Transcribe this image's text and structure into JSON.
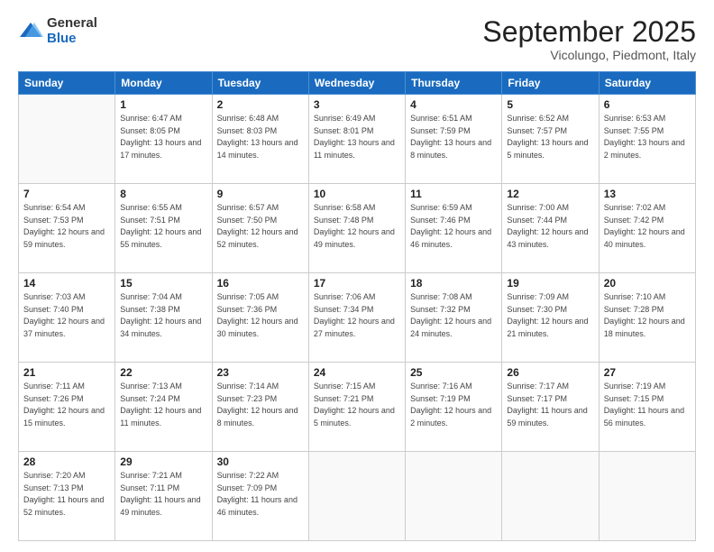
{
  "logo": {
    "general": "General",
    "blue": "Blue"
  },
  "header": {
    "title": "September 2025",
    "location": "Vicolungo, Piedmont, Italy"
  },
  "weekdays": [
    "Sunday",
    "Monday",
    "Tuesday",
    "Wednesday",
    "Thursday",
    "Friday",
    "Saturday"
  ],
  "weeks": [
    [
      {
        "day": "",
        "sunrise": "",
        "sunset": "",
        "daylight": ""
      },
      {
        "day": "1",
        "sunrise": "Sunrise: 6:47 AM",
        "sunset": "Sunset: 8:05 PM",
        "daylight": "Daylight: 13 hours and 17 minutes."
      },
      {
        "day": "2",
        "sunrise": "Sunrise: 6:48 AM",
        "sunset": "Sunset: 8:03 PM",
        "daylight": "Daylight: 13 hours and 14 minutes."
      },
      {
        "day": "3",
        "sunrise": "Sunrise: 6:49 AM",
        "sunset": "Sunset: 8:01 PM",
        "daylight": "Daylight: 13 hours and 11 minutes."
      },
      {
        "day": "4",
        "sunrise": "Sunrise: 6:51 AM",
        "sunset": "Sunset: 7:59 PM",
        "daylight": "Daylight: 13 hours and 8 minutes."
      },
      {
        "day": "5",
        "sunrise": "Sunrise: 6:52 AM",
        "sunset": "Sunset: 7:57 PM",
        "daylight": "Daylight: 13 hours and 5 minutes."
      },
      {
        "day": "6",
        "sunrise": "Sunrise: 6:53 AM",
        "sunset": "Sunset: 7:55 PM",
        "daylight": "Daylight: 13 hours and 2 minutes."
      }
    ],
    [
      {
        "day": "7",
        "sunrise": "Sunrise: 6:54 AM",
        "sunset": "Sunset: 7:53 PM",
        "daylight": "Daylight: 12 hours and 59 minutes."
      },
      {
        "day": "8",
        "sunrise": "Sunrise: 6:55 AM",
        "sunset": "Sunset: 7:51 PM",
        "daylight": "Daylight: 12 hours and 55 minutes."
      },
      {
        "day": "9",
        "sunrise": "Sunrise: 6:57 AM",
        "sunset": "Sunset: 7:50 PM",
        "daylight": "Daylight: 12 hours and 52 minutes."
      },
      {
        "day": "10",
        "sunrise": "Sunrise: 6:58 AM",
        "sunset": "Sunset: 7:48 PM",
        "daylight": "Daylight: 12 hours and 49 minutes."
      },
      {
        "day": "11",
        "sunrise": "Sunrise: 6:59 AM",
        "sunset": "Sunset: 7:46 PM",
        "daylight": "Daylight: 12 hours and 46 minutes."
      },
      {
        "day": "12",
        "sunrise": "Sunrise: 7:00 AM",
        "sunset": "Sunset: 7:44 PM",
        "daylight": "Daylight: 12 hours and 43 minutes."
      },
      {
        "day": "13",
        "sunrise": "Sunrise: 7:02 AM",
        "sunset": "Sunset: 7:42 PM",
        "daylight": "Daylight: 12 hours and 40 minutes."
      }
    ],
    [
      {
        "day": "14",
        "sunrise": "Sunrise: 7:03 AM",
        "sunset": "Sunset: 7:40 PM",
        "daylight": "Daylight: 12 hours and 37 minutes."
      },
      {
        "day": "15",
        "sunrise": "Sunrise: 7:04 AM",
        "sunset": "Sunset: 7:38 PM",
        "daylight": "Daylight: 12 hours and 34 minutes."
      },
      {
        "day": "16",
        "sunrise": "Sunrise: 7:05 AM",
        "sunset": "Sunset: 7:36 PM",
        "daylight": "Daylight: 12 hours and 30 minutes."
      },
      {
        "day": "17",
        "sunrise": "Sunrise: 7:06 AM",
        "sunset": "Sunset: 7:34 PM",
        "daylight": "Daylight: 12 hours and 27 minutes."
      },
      {
        "day": "18",
        "sunrise": "Sunrise: 7:08 AM",
        "sunset": "Sunset: 7:32 PM",
        "daylight": "Daylight: 12 hours and 24 minutes."
      },
      {
        "day": "19",
        "sunrise": "Sunrise: 7:09 AM",
        "sunset": "Sunset: 7:30 PM",
        "daylight": "Daylight: 12 hours and 21 minutes."
      },
      {
        "day": "20",
        "sunrise": "Sunrise: 7:10 AM",
        "sunset": "Sunset: 7:28 PM",
        "daylight": "Daylight: 12 hours and 18 minutes."
      }
    ],
    [
      {
        "day": "21",
        "sunrise": "Sunrise: 7:11 AM",
        "sunset": "Sunset: 7:26 PM",
        "daylight": "Daylight: 12 hours and 15 minutes."
      },
      {
        "day": "22",
        "sunrise": "Sunrise: 7:13 AM",
        "sunset": "Sunset: 7:24 PM",
        "daylight": "Daylight: 12 hours and 11 minutes."
      },
      {
        "day": "23",
        "sunrise": "Sunrise: 7:14 AM",
        "sunset": "Sunset: 7:23 PM",
        "daylight": "Daylight: 12 hours and 8 minutes."
      },
      {
        "day": "24",
        "sunrise": "Sunrise: 7:15 AM",
        "sunset": "Sunset: 7:21 PM",
        "daylight": "Daylight: 12 hours and 5 minutes."
      },
      {
        "day": "25",
        "sunrise": "Sunrise: 7:16 AM",
        "sunset": "Sunset: 7:19 PM",
        "daylight": "Daylight: 12 hours and 2 minutes."
      },
      {
        "day": "26",
        "sunrise": "Sunrise: 7:17 AM",
        "sunset": "Sunset: 7:17 PM",
        "daylight": "Daylight: 11 hours and 59 minutes."
      },
      {
        "day": "27",
        "sunrise": "Sunrise: 7:19 AM",
        "sunset": "Sunset: 7:15 PM",
        "daylight": "Daylight: 11 hours and 56 minutes."
      }
    ],
    [
      {
        "day": "28",
        "sunrise": "Sunrise: 7:20 AM",
        "sunset": "Sunset: 7:13 PM",
        "daylight": "Daylight: 11 hours and 52 minutes."
      },
      {
        "day": "29",
        "sunrise": "Sunrise: 7:21 AM",
        "sunset": "Sunset: 7:11 PM",
        "daylight": "Daylight: 11 hours and 49 minutes."
      },
      {
        "day": "30",
        "sunrise": "Sunrise: 7:22 AM",
        "sunset": "Sunset: 7:09 PM",
        "daylight": "Daylight: 11 hours and 46 minutes."
      },
      {
        "day": "",
        "sunrise": "",
        "sunset": "",
        "daylight": ""
      },
      {
        "day": "",
        "sunrise": "",
        "sunset": "",
        "daylight": ""
      },
      {
        "day": "",
        "sunrise": "",
        "sunset": "",
        "daylight": ""
      },
      {
        "day": "",
        "sunrise": "",
        "sunset": "",
        "daylight": ""
      }
    ]
  ]
}
